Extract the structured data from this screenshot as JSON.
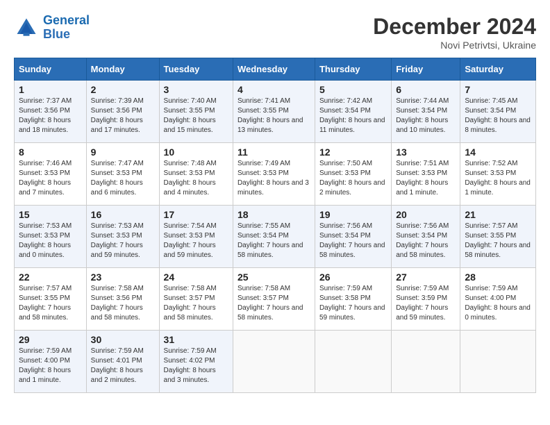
{
  "header": {
    "logo_line1": "General",
    "logo_line2": "Blue",
    "month": "December 2024",
    "location": "Novi Petrivtsi, Ukraine"
  },
  "days_of_week": [
    "Sunday",
    "Monday",
    "Tuesday",
    "Wednesday",
    "Thursday",
    "Friday",
    "Saturday"
  ],
  "weeks": [
    [
      {
        "day": 1,
        "info": "Sunrise: 7:37 AM\nSunset: 3:56 PM\nDaylight: 8 hours and 18 minutes."
      },
      {
        "day": 2,
        "info": "Sunrise: 7:39 AM\nSunset: 3:56 PM\nDaylight: 8 hours and 17 minutes."
      },
      {
        "day": 3,
        "info": "Sunrise: 7:40 AM\nSunset: 3:55 PM\nDaylight: 8 hours and 15 minutes."
      },
      {
        "day": 4,
        "info": "Sunrise: 7:41 AM\nSunset: 3:55 PM\nDaylight: 8 hours and 13 minutes."
      },
      {
        "day": 5,
        "info": "Sunrise: 7:42 AM\nSunset: 3:54 PM\nDaylight: 8 hours and 11 minutes."
      },
      {
        "day": 6,
        "info": "Sunrise: 7:44 AM\nSunset: 3:54 PM\nDaylight: 8 hours and 10 minutes."
      },
      {
        "day": 7,
        "info": "Sunrise: 7:45 AM\nSunset: 3:54 PM\nDaylight: 8 hours and 8 minutes."
      }
    ],
    [
      {
        "day": 8,
        "info": "Sunrise: 7:46 AM\nSunset: 3:53 PM\nDaylight: 8 hours and 7 minutes."
      },
      {
        "day": 9,
        "info": "Sunrise: 7:47 AM\nSunset: 3:53 PM\nDaylight: 8 hours and 6 minutes."
      },
      {
        "day": 10,
        "info": "Sunrise: 7:48 AM\nSunset: 3:53 PM\nDaylight: 8 hours and 4 minutes."
      },
      {
        "day": 11,
        "info": "Sunrise: 7:49 AM\nSunset: 3:53 PM\nDaylight: 8 hours and 3 minutes."
      },
      {
        "day": 12,
        "info": "Sunrise: 7:50 AM\nSunset: 3:53 PM\nDaylight: 8 hours and 2 minutes."
      },
      {
        "day": 13,
        "info": "Sunrise: 7:51 AM\nSunset: 3:53 PM\nDaylight: 8 hours and 1 minute."
      },
      {
        "day": 14,
        "info": "Sunrise: 7:52 AM\nSunset: 3:53 PM\nDaylight: 8 hours and 1 minute."
      }
    ],
    [
      {
        "day": 15,
        "info": "Sunrise: 7:53 AM\nSunset: 3:53 PM\nDaylight: 8 hours and 0 minutes."
      },
      {
        "day": 16,
        "info": "Sunrise: 7:53 AM\nSunset: 3:53 PM\nDaylight: 7 hours and 59 minutes."
      },
      {
        "day": 17,
        "info": "Sunrise: 7:54 AM\nSunset: 3:53 PM\nDaylight: 7 hours and 59 minutes."
      },
      {
        "day": 18,
        "info": "Sunrise: 7:55 AM\nSunset: 3:54 PM\nDaylight: 7 hours and 58 minutes."
      },
      {
        "day": 19,
        "info": "Sunrise: 7:56 AM\nSunset: 3:54 PM\nDaylight: 7 hours and 58 minutes."
      },
      {
        "day": 20,
        "info": "Sunrise: 7:56 AM\nSunset: 3:54 PM\nDaylight: 7 hours and 58 minutes."
      },
      {
        "day": 21,
        "info": "Sunrise: 7:57 AM\nSunset: 3:55 PM\nDaylight: 7 hours and 58 minutes."
      }
    ],
    [
      {
        "day": 22,
        "info": "Sunrise: 7:57 AM\nSunset: 3:55 PM\nDaylight: 7 hours and 58 minutes."
      },
      {
        "day": 23,
        "info": "Sunrise: 7:58 AM\nSunset: 3:56 PM\nDaylight: 7 hours and 58 minutes."
      },
      {
        "day": 24,
        "info": "Sunrise: 7:58 AM\nSunset: 3:57 PM\nDaylight: 7 hours and 58 minutes."
      },
      {
        "day": 25,
        "info": "Sunrise: 7:58 AM\nSunset: 3:57 PM\nDaylight: 7 hours and 58 minutes."
      },
      {
        "day": 26,
        "info": "Sunrise: 7:59 AM\nSunset: 3:58 PM\nDaylight: 7 hours and 59 minutes."
      },
      {
        "day": 27,
        "info": "Sunrise: 7:59 AM\nSunset: 3:59 PM\nDaylight: 7 hours and 59 minutes."
      },
      {
        "day": 28,
        "info": "Sunrise: 7:59 AM\nSunset: 4:00 PM\nDaylight: 8 hours and 0 minutes."
      }
    ],
    [
      {
        "day": 29,
        "info": "Sunrise: 7:59 AM\nSunset: 4:00 PM\nDaylight: 8 hours and 1 minute."
      },
      {
        "day": 30,
        "info": "Sunrise: 7:59 AM\nSunset: 4:01 PM\nDaylight: 8 hours and 2 minutes."
      },
      {
        "day": 31,
        "info": "Sunrise: 7:59 AM\nSunset: 4:02 PM\nDaylight: 8 hours and 3 minutes."
      },
      null,
      null,
      null,
      null
    ]
  ]
}
